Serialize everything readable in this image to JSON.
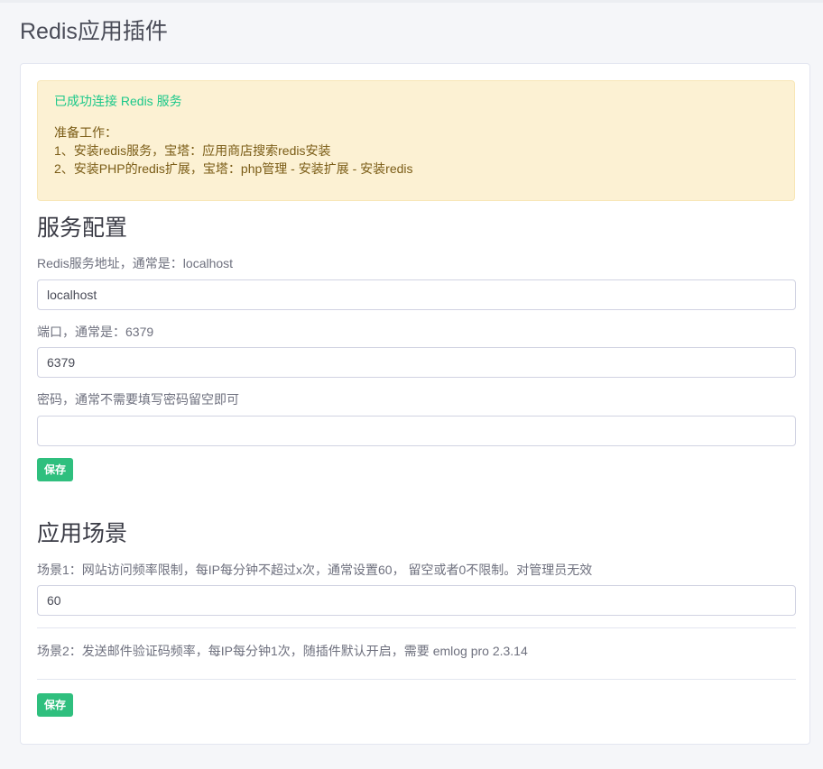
{
  "page": {
    "title": "Redis应用插件"
  },
  "alert": {
    "status": "已成功连接 Redis 服务",
    "prep_title": "准备工作：",
    "step1": "1、安装redis服务，宝塔：应用商店搜索redis安装",
    "step2": "2、安装PHP的redis扩展，宝塔：php管理 - 安装扩展 - 安装redis"
  },
  "service_config": {
    "heading": "服务配置",
    "host_label": "Redis服务地址，通常是：localhost",
    "host_value": "localhost",
    "port_label": "端口，通常是：6379",
    "port_value": "6379",
    "password_label": "密码，通常不需要填写密码留空即可",
    "password_value": "",
    "save_label": "保存"
  },
  "scenarios": {
    "heading": "应用场景",
    "scene1_label": "场景1：网站访问频率限制，每IP每分钟不超过x次，通常设置60， 留空或者0不限制。对管理员无效",
    "scene1_value": "60",
    "scene2_text": "场景2：发送邮件验证码频率，每IP每分钟1次，随插件默认开启，需要 emlog pro 2.3.14",
    "save_label": "保存"
  },
  "colors": {
    "accent": "#2fbf7e",
    "success_text": "#1cc88a",
    "alert_bg": "#fcf1d3"
  }
}
